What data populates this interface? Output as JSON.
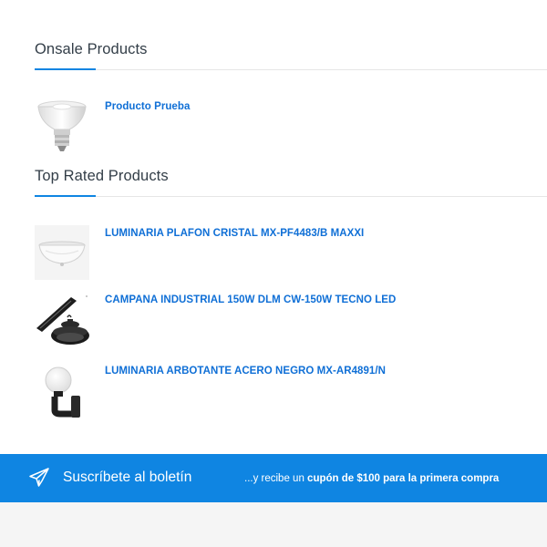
{
  "onsale": {
    "title": "Onsale Products",
    "products": [
      {
        "name": "Producto Prueba",
        "image_icon": "led-bulb-image"
      }
    ]
  },
  "top_rated": {
    "title": "Top Rated Products",
    "products": [
      {
        "name": "LUMINARIA PLAFON CRISTAL MX-PF4483/B MAXXI",
        "image_icon": "ceiling-lamp-image"
      },
      {
        "name": "CAMPANA INDUSTRIAL 150W DLM CW-150W TECNO LED",
        "image_icon": "industrial-bell-lamp-image"
      },
      {
        "name": "LUMINARIA ARBOTANTE ACERO NEGRO MX-AR4891/N",
        "image_icon": "wall-lamp-image"
      }
    ]
  },
  "newsletter": {
    "title": "Suscríbete al boletín",
    "offer_prefix": "...y recibe un ",
    "offer_bold": "cupón de $100 para la primera compra",
    "icon": "paper-plane-icon"
  },
  "colors": {
    "accent": "#0f85e2",
    "link": "#0f6fd6",
    "footer_bg": "#f5f5f5"
  }
}
